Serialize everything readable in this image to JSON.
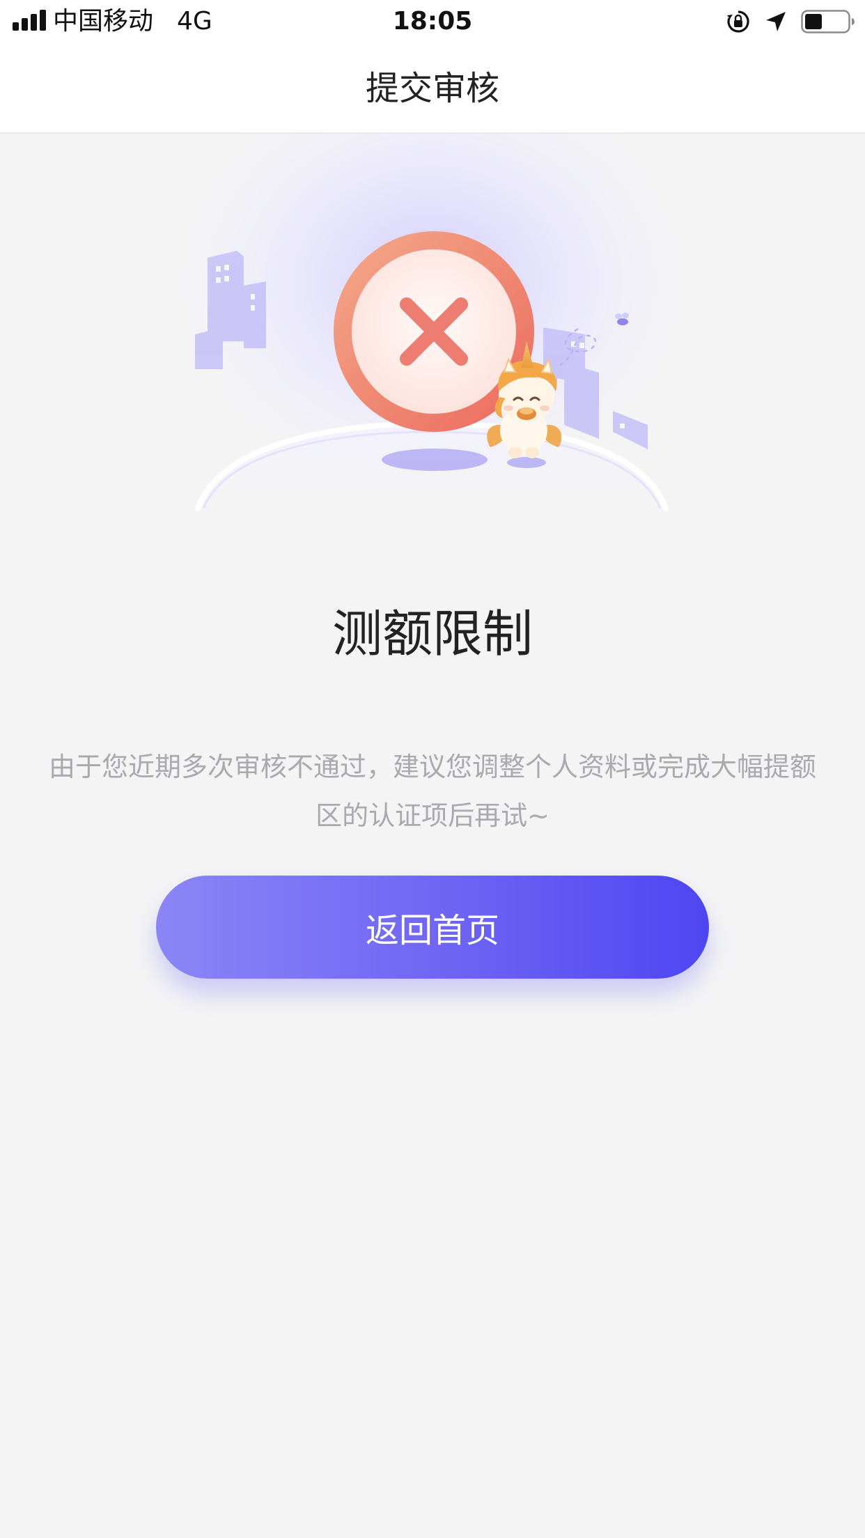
{
  "status_bar": {
    "carrier": "中国移动",
    "network": "4G",
    "time": "18:05",
    "signal_bars": 4,
    "battery_level": 0.4,
    "icons": [
      "signal-icon",
      "orientation-lock-icon",
      "location-arrow-icon",
      "battery-icon"
    ]
  },
  "nav": {
    "title": "提交审核"
  },
  "result": {
    "title": "测额限制",
    "description": "由于您近期多次审核不通过，建议您调整个人资料或完成大幅提额区的认证项后再试~"
  },
  "actions": {
    "home_label": "返回首页"
  },
  "colors": {
    "accent_start": "#8b86f6",
    "accent_end": "#4e46f1",
    "error_ring": "#ee7c6a",
    "error_x": "#ec7d70",
    "background": "#f4f4f5"
  },
  "illustration": {
    "status_icon": "error-x-icon",
    "mascot": "unicorn-mascot"
  }
}
